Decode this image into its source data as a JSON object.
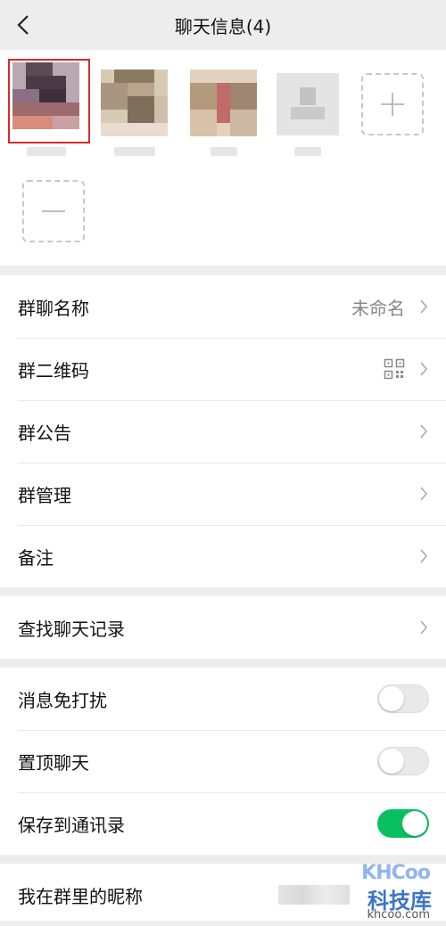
{
  "header": {
    "title": "聊天信息(4)"
  },
  "members": {
    "add_label": "+",
    "remove_label": "—"
  },
  "settings": {
    "group_name": {
      "label": "群聊名称",
      "value": "未命名"
    },
    "qr_code": {
      "label": "群二维码"
    },
    "announcement": {
      "label": "群公告"
    },
    "management": {
      "label": "群管理"
    },
    "remark": {
      "label": "备注"
    },
    "search_history": {
      "label": "查找聊天记录"
    },
    "mute": {
      "label": "消息免打扰",
      "enabled": false
    },
    "pin": {
      "label": "置顶聊天",
      "enabled": false
    },
    "save_contacts": {
      "label": "保存到通讯录",
      "enabled": true
    },
    "my_nickname": {
      "label": "我在群里的昵称"
    }
  },
  "watermark": {
    "logo": "KHCoo",
    "name": "科技库",
    "url": "khcoo.com"
  },
  "colors": {
    "accent_green": "#07c160",
    "highlight_red": "#d62b2b",
    "background": "#ededed"
  }
}
